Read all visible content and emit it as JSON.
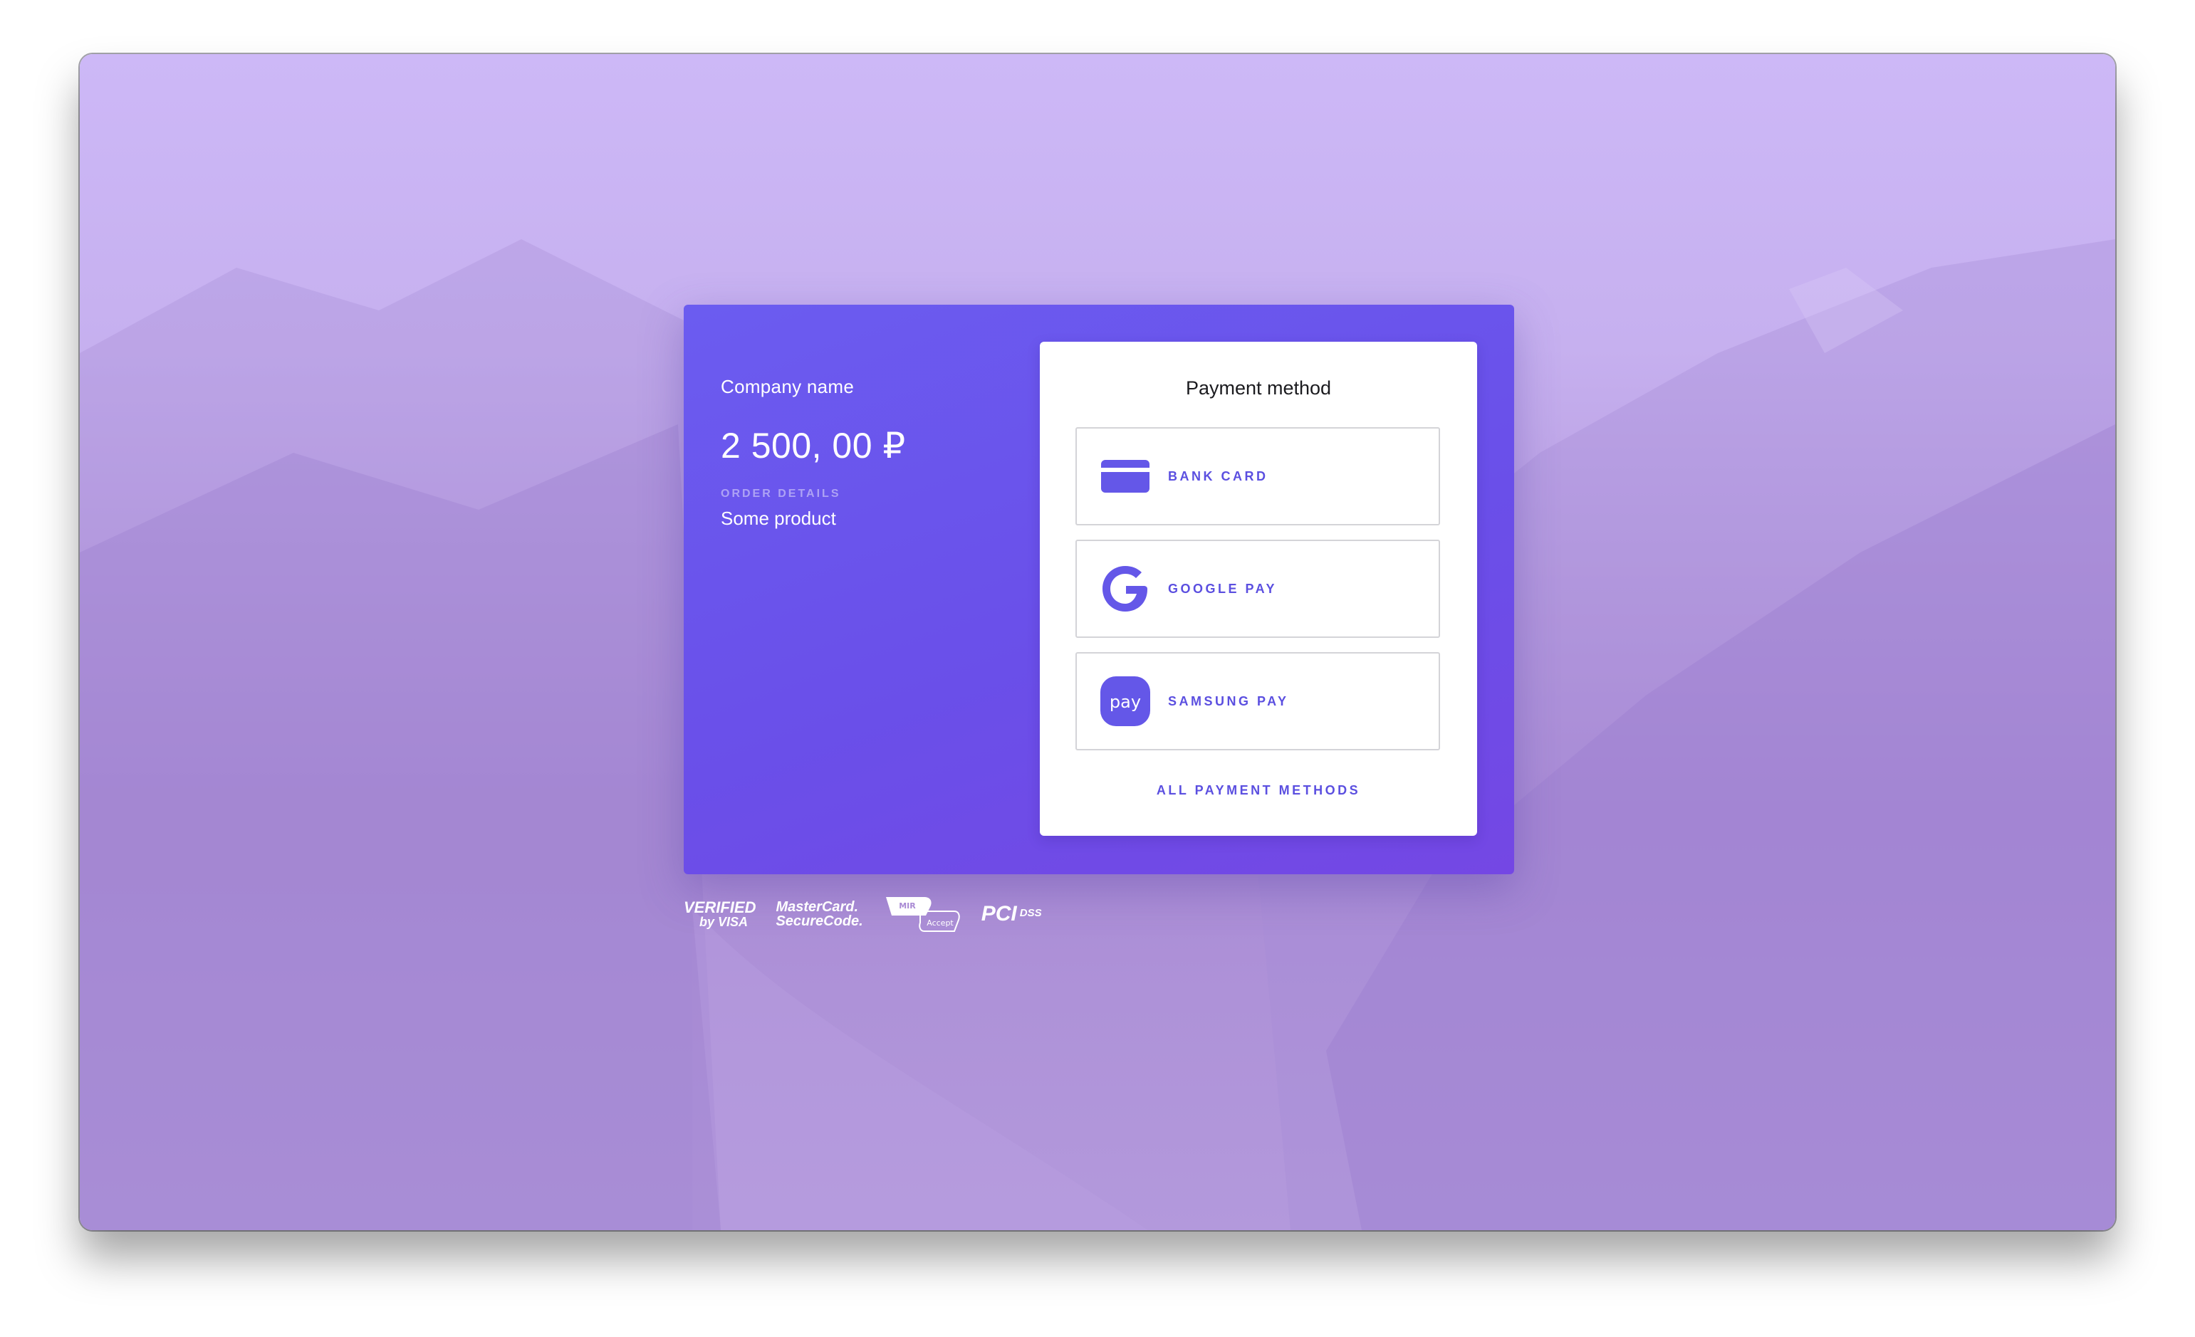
{
  "summary": {
    "company": "Company name",
    "amount": "2 500, 00 ₽",
    "order_details_label": "ORDER DETAILS",
    "product": "Some product"
  },
  "payment": {
    "title": "Payment method",
    "methods": [
      {
        "label": "BANK CARD",
        "icon": "credit-card-icon"
      },
      {
        "label": "GOOGLE PAY",
        "icon": "google-g-icon"
      },
      {
        "label": "SAMSUNG PAY",
        "icon": "samsung-pay-icon"
      }
    ],
    "all_methods_label": "ALL PAYMENT METHODS",
    "samsung_icon_text": "pay"
  },
  "badges": {
    "visa_line1": "VERIFIED",
    "visa_line2": "by VISA",
    "mc_line1": "MasterCard.",
    "mc_line2": "SecureCode.",
    "mir_top": "MIR",
    "mir_bottom": "Accept",
    "pci": "PCI",
    "dss": "DSS"
  },
  "colors": {
    "accent": "#5b4fe0",
    "card_gradient_start": "#6b5cf0",
    "card_gradient_end": "#7447e4"
  }
}
